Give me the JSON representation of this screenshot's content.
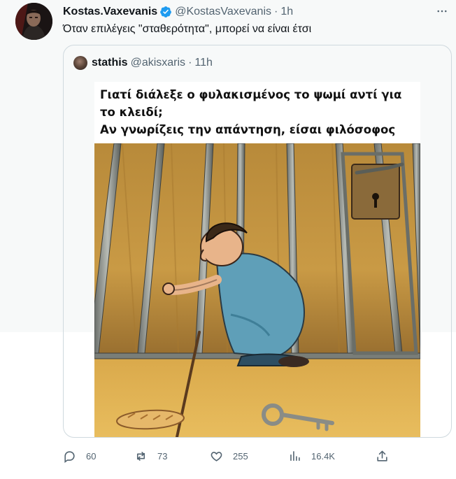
{
  "author": {
    "name": "Kostas.Vaxevanis",
    "handle": "@KostasVaxevanis",
    "separator": "·",
    "time": "1h",
    "verified": true
  },
  "tweet_text": "Όταν επιλέγεις \"σταθερότητα\", μπορεί να είναι έτσι",
  "quoted": {
    "name": "stathis",
    "handle": "@akisxaris",
    "separator": "·",
    "time": "11h",
    "caption_line1": "Γιατί διάλεξε ο φυλακισμένος το ψωμί αντί για",
    "caption_line2": "το κλειδί;",
    "caption_line3": "Αν γνωρίζεις την απάντηση, είσαι φιλόσοφος"
  },
  "actions": {
    "replies": "60",
    "retweets": "73",
    "likes": "255",
    "views": "16.4K"
  },
  "icons": {
    "more": "more-icon",
    "reply": "reply-icon",
    "retweet": "retweet-icon",
    "like": "like-icon",
    "views": "views-icon",
    "share": "share-icon",
    "verified": "verified-badge-icon"
  },
  "colors": {
    "verified": "#1d9bf0",
    "muted": "#536471",
    "border": "#cfd9de",
    "background_top": "#f7f9f9",
    "background_bottom": "#ffffff"
  }
}
